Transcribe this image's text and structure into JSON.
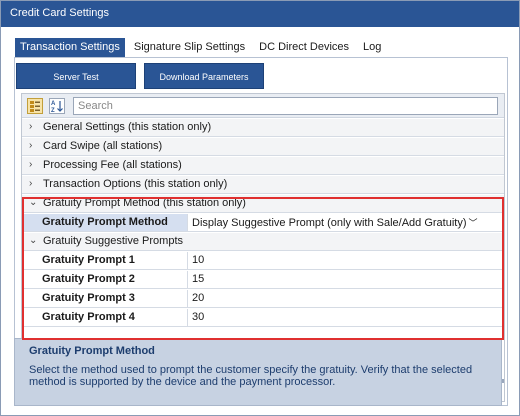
{
  "window": {
    "title": "Credit Card Settings"
  },
  "tabs": [
    {
      "label": "Transaction Settings",
      "active": true
    },
    {
      "label": "Signature Slip Settings",
      "active": false
    },
    {
      "label": "DC Direct Devices",
      "active": false
    },
    {
      "label": "Log",
      "active": false
    }
  ],
  "buttons": {
    "server_test": "Server Test",
    "download_parameters": "Download Parameters"
  },
  "toolbar": {
    "categorized_icon": "categorized-view-icon",
    "alphabetical_icon": "alphabetical-sort-icon",
    "alphabetical_glyph": "A↓Z",
    "search_placeholder": "Search"
  },
  "categories": {
    "general": "General Settings (this station only)",
    "card_swipe": "Card Swipe (all stations)",
    "processing_fee": "Processing Fee (all stations)",
    "transaction_options": "Transaction Options (this station only)",
    "gratuity_method": "Gratuity Prompt Method (this station only)",
    "gratuity_suggestive": "Gratuity Suggestive Prompts"
  },
  "properties": {
    "gratuity_prompt_method": {
      "name": "Gratuity Prompt Method",
      "value": "Display Suggestive Prompt (only with Sale/Add Gratuity)"
    },
    "prompt1": {
      "name": "Gratuity Prompt 1",
      "value": "10"
    },
    "prompt2": {
      "name": "Gratuity Prompt 2",
      "value": "15"
    },
    "prompt3": {
      "name": "Gratuity Prompt 3",
      "value": "20"
    },
    "prompt4": {
      "name": "Gratuity Prompt 4",
      "value": "30"
    }
  },
  "description": {
    "title": "Gratuity Prompt Method",
    "text": "Select the method used to prompt the customer specify the gratuity. Verify that the selected method is supported by the device and the payment processor."
  },
  "colors": {
    "accent": "#2a5595",
    "highlight": "#e03030",
    "selected_row": "#d5dff0",
    "description_bg": "#c7d2e2"
  }
}
